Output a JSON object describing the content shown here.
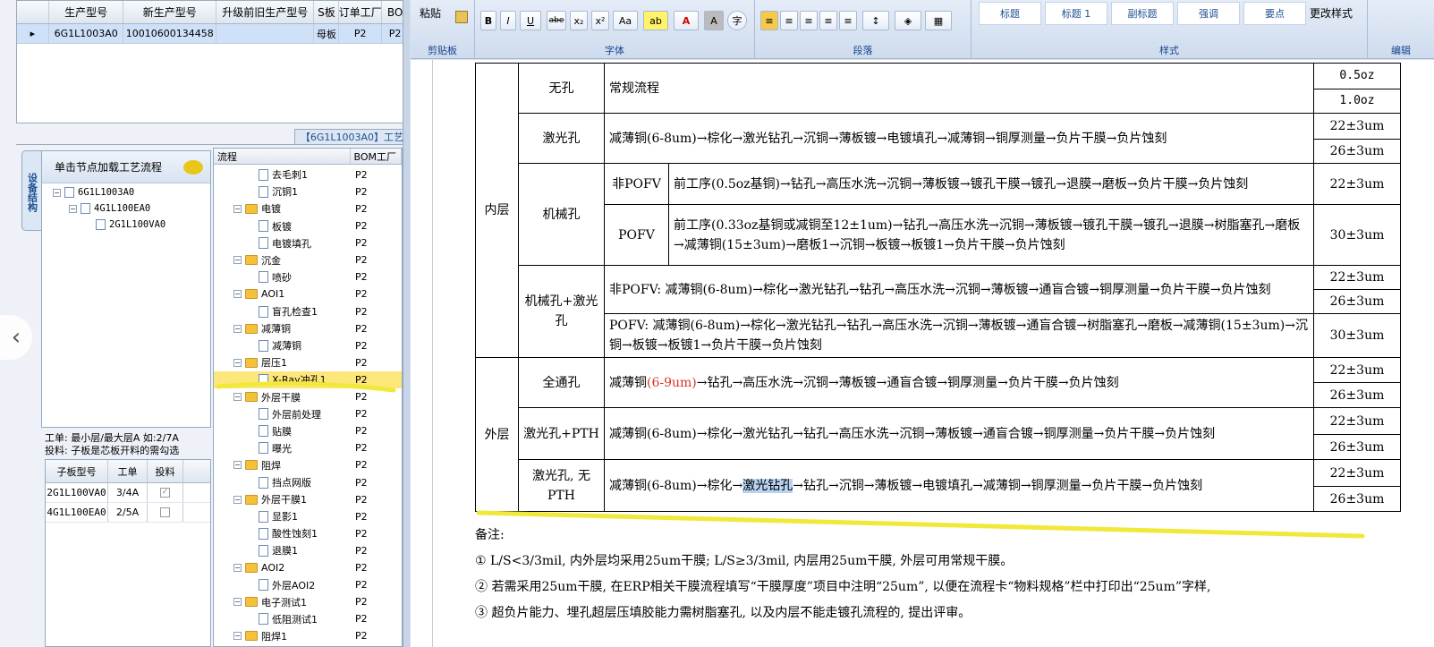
{
  "top_grid": {
    "headers": [
      "生产型号",
      "新生产型号",
      "升级前旧生产型号",
      "S板",
      "订单工厂",
      "BO"
    ],
    "row": [
      "6G1L1003A0",
      "10010600134458",
      "",
      "母板",
      "P2",
      "P2"
    ]
  },
  "tab_label": "【6G1L1003A0】工艺",
  "vertical_tab": "设备结构",
  "tree": {
    "header": "单击节点加载工艺流程",
    "nodes": [
      "6G1L1003A0",
      "4G1L100EA0",
      "2G1L100VA0"
    ]
  },
  "info": {
    "line1": "工单: 最小层/最大层A 如:2/7A",
    "line2": "投料: 子板是芯板开料的需勾选"
  },
  "sub_grid": {
    "headers": [
      "子板型号",
      "工单",
      "投料"
    ],
    "rows": [
      {
        "model": "2G1L100VA0",
        "order": "3/4A",
        "checked": "✓"
      },
      {
        "model": "4G1L100EA0",
        "order": "2/5A",
        "checked": ""
      }
    ]
  },
  "flow": {
    "headers": [
      "流程",
      "BOM工厂"
    ],
    "items": [
      {
        "label": "去毛刺1",
        "bom": "P2",
        "type": "leaf"
      },
      {
        "label": "沉铜1",
        "bom": "P2",
        "type": "leaf"
      },
      {
        "label": "电镀",
        "bom": "P2",
        "type": "folder"
      },
      {
        "label": "板镀",
        "bom": "P2",
        "type": "leaf"
      },
      {
        "label": "电镀填孔",
        "bom": "P2",
        "type": "leaf"
      },
      {
        "label": "沉金",
        "bom": "P2",
        "type": "folder"
      },
      {
        "label": "喷砂",
        "bom": "P2",
        "type": "leaf"
      },
      {
        "label": "AOI1",
        "bom": "P2",
        "type": "folder"
      },
      {
        "label": "盲孔检查1",
        "bom": "P2",
        "type": "leaf"
      },
      {
        "label": "减薄铜",
        "bom": "P2",
        "type": "folder"
      },
      {
        "label": "减薄铜",
        "bom": "P2",
        "type": "leaf"
      },
      {
        "label": "层压1",
        "bom": "P2",
        "type": "folder"
      },
      {
        "label": "X-Ray冲孔1",
        "bom": "P2",
        "type": "leaf",
        "selected": true
      },
      {
        "label": "外层干膜",
        "bom": "P2",
        "type": "folder"
      },
      {
        "label": "外层前处理",
        "bom": "P2",
        "type": "leaf"
      },
      {
        "label": "贴膜",
        "bom": "P2",
        "type": "leaf"
      },
      {
        "label": "曝光",
        "bom": "P2",
        "type": "leaf"
      },
      {
        "label": "阻焊",
        "bom": "P2",
        "type": "folder"
      },
      {
        "label": "挡点网版",
        "bom": "P2",
        "type": "leaf"
      },
      {
        "label": "外层干膜1",
        "bom": "P2",
        "type": "folder"
      },
      {
        "label": "显影1",
        "bom": "P2",
        "type": "leaf"
      },
      {
        "label": "酸性蚀刻1",
        "bom": "P2",
        "type": "leaf"
      },
      {
        "label": "退膜1",
        "bom": "P2",
        "type": "leaf"
      },
      {
        "label": "AOI2",
        "bom": "P2",
        "type": "folder"
      },
      {
        "label": "外层AOI2",
        "bom": "P2",
        "type": "leaf"
      },
      {
        "label": "电子测试1",
        "bom": "P2",
        "type": "folder"
      },
      {
        "label": "低阻测试1",
        "bom": "P2",
        "type": "leaf"
      },
      {
        "label": "阻焊1",
        "bom": "P2",
        "type": "folder"
      }
    ]
  },
  "ribbon": {
    "paste": "粘贴",
    "clipboard": "剪贴板",
    "font": "字体",
    "paragraph": "段落",
    "styles_group": "样式",
    "edit": "编辑",
    "change_styles": "更改样式",
    "styles": [
      "标题",
      "标题 1",
      "副标题",
      "强调",
      "要点"
    ],
    "font_buttons": [
      "B",
      "I",
      "U",
      "abe",
      "x₂",
      "x²",
      "Aa"
    ]
  },
  "table": {
    "r_wukong": {
      "type": "无孔",
      "flow": "常规流程",
      "th1": "0.5oz",
      "th2": "1.0oz"
    },
    "r_laser": {
      "type": "激光孔",
      "flow": "减薄铜(6-8um)→棕化→激光钻孔→沉铜→薄板镀→电镀填孔→减薄铜→铜厚测量→负片干膜→负片蚀刻",
      "th1": "22±3um",
      "th2": "26±3um"
    },
    "inner": "内层",
    "outer": "外层",
    "r_mech": {
      "type": "机械孔",
      "sub1": "非POFV",
      "flow1": "前工序(0.5oz基铜)→钻孔→高压水洗→沉铜→薄板镀→镀孔干膜→镀孔→退膜→磨板→负片干膜→负片蚀刻",
      "th1": "22±3um",
      "sub2": "POFV",
      "flow2": "前工序(0.33oz基铜或减铜至12±1um)→钻孔→高压水洗→沉铜→薄板镀→镀孔干膜→镀孔→退膜→树脂塞孔→磨板→减薄铜(15±3um)→磨板1→沉铜→板镀→板镀1→负片干膜→负片蚀刻",
      "th2": "30±3um"
    },
    "r_mechlaser": {
      "type": "机械孔+激光孔",
      "flow1": "非POFV: 减薄铜(6-8um)→棕化→激光钻孔→钻孔→高压水洗→沉铜→薄板镀→通盲合镀→铜厚测量→负片干膜→负片蚀刻",
      "th1": "22±3um",
      "th2": "26±3um",
      "flow2": "POFV: 减薄铜(6-8um)→棕化→激光钻孔→钻孔→高压水洗→沉铜→薄板镀→通盲合镀→树脂塞孔→磨板→减薄铜(15±3um)→沉铜→板镀→板镀1→负片干膜→负片蚀刻",
      "th3": "30±3um"
    },
    "r_through": {
      "type": "全通孔",
      "flow_pre": "减薄铜",
      "flow_red": "(6-9um)",
      "flow_post": "→钻孔→高压水洗→沉铜→薄板镀→通盲合镀→铜厚测量→负片干膜→负片蚀刻",
      "th1": "22±3um",
      "th2": "26±3um"
    },
    "r_laserpth": {
      "type": "激光孔+PTH",
      "flow": "减薄铜(6-8um)→棕化→激光钻孔→钻孔→高压水洗→沉铜→薄板镀→通盲合镀→铜厚测量→负片干膜→负片蚀刻",
      "th1": "22±3um",
      "th2": "26±3um"
    },
    "r_lasernopth": {
      "type": "激光孔, 无PTH",
      "flow_pre": "减薄铜(6-8um)→棕化→",
      "flow_hl": "激光钻孔",
      "flow_post": "→钻孔→沉铜→薄板镀→电镀填孔→减薄铜→铜厚测量→负片干膜→负片蚀刻",
      "th1": "22±3um",
      "th2": "26±3um"
    }
  },
  "notes": {
    "title": "备注:",
    "n1": "① L/S<3/3mil, 内外层均采用25um干膜; L/S≥3/3mil, 内层用25um干膜, 外层可用常规干膜。",
    "n2": "② 若需采用25um干膜, 在ERP相关干膜流程填写“干膜厚度”项目中注明“25um”, 以便在流程卡“物料规格”栏中打印出“25um”字样,",
    "n3": "③ 超负片能力、埋孔超层压填胶能力需树脂塞孔, 以及内层不能走镀孔流程的, 提出评审。"
  }
}
